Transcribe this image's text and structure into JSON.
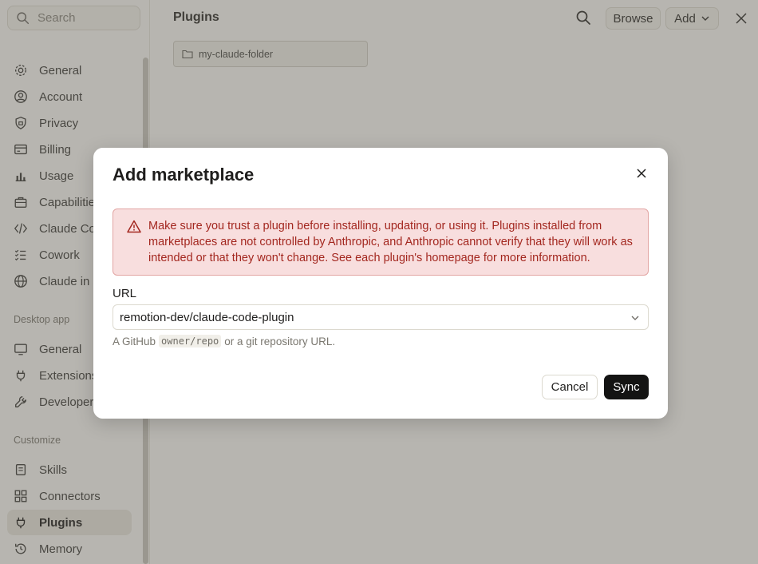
{
  "sidebar": {
    "search_placeholder": "Search",
    "settings_items": [
      {
        "label": "General",
        "icon": "gear-icon"
      },
      {
        "label": "Account",
        "icon": "user-circle-icon"
      },
      {
        "label": "Privacy",
        "icon": "shield-icon"
      },
      {
        "label": "Billing",
        "icon": "credit-card-icon"
      },
      {
        "label": "Usage",
        "icon": "bar-chart-icon"
      },
      {
        "label": "Capabilities",
        "icon": "briefcase-icon"
      },
      {
        "label": "Claude Code",
        "icon": "code-icon"
      },
      {
        "label": "Cowork",
        "icon": "checklist-icon"
      },
      {
        "label": "Claude in Chrome",
        "icon": "globe-icon"
      }
    ],
    "desktop_section": "Desktop app",
    "desktop_items": [
      {
        "label": "General",
        "icon": "monitor-icon"
      },
      {
        "label": "Extensions",
        "icon": "plug-icon"
      },
      {
        "label": "Developer",
        "icon": "wrench-icon"
      }
    ],
    "customize_section": "Customize",
    "customize_items": [
      {
        "label": "Skills",
        "icon": "skills-icon"
      },
      {
        "label": "Connectors",
        "icon": "connectors-icon"
      },
      {
        "label": "Plugins",
        "icon": "plug-icon",
        "active": true
      },
      {
        "label": "Memory",
        "icon": "memory-icon"
      }
    ]
  },
  "main": {
    "title": "Plugins",
    "browse_label": "Browse",
    "add_label": "Add",
    "folder_name": "my-claude-folder"
  },
  "modal": {
    "title": "Add marketplace",
    "warning": "Make sure you trust a plugin before installing, updating, or using it. Plugins installed from marketplaces are not controlled by Anthropic, and Anthropic cannot verify that they will work as intended or that they won't change. See each plugin's homepage for more information.",
    "url_label": "URL",
    "url_value": "remotion-dev/claude-code-plugin",
    "hint_prefix": "A GitHub",
    "hint_code": "owner/repo",
    "hint_suffix": "or a git repository URL.",
    "cancel_label": "Cancel",
    "sync_label": "Sync"
  },
  "colors": {
    "accent_dark": "#141413",
    "warning_text": "#a3271f",
    "warning_bg": "#f8dede"
  }
}
